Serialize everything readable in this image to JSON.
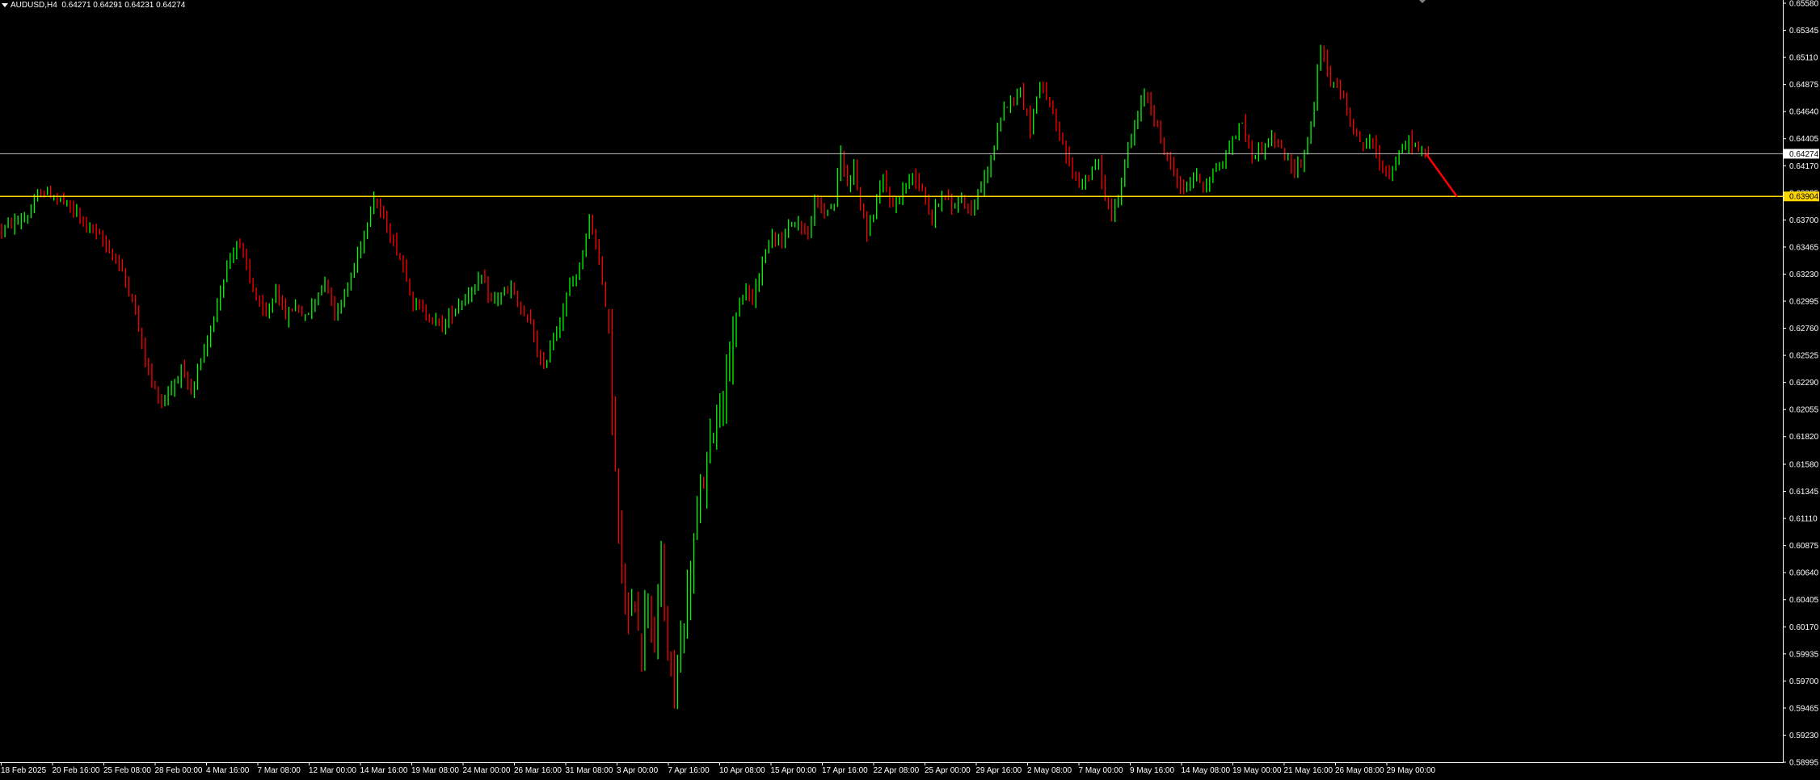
{
  "header": {
    "symbol": "AUDUSD,H4",
    "ohlc": "0.64271 0.64291 0.64231 0.64274"
  },
  "colors": {
    "background": "#000000",
    "bull": "#00ff00",
    "bear": "#ff0000",
    "axis": "#ffffff",
    "support_line": "#ffd700",
    "price_line": "#c0c0c0",
    "arrow": "#ff0000"
  },
  "chart_data": {
    "type": "candlestick",
    "y_ticks": [
      "0.65580",
      "0.65345",
      "0.65110",
      "0.64875",
      "0.64640",
      "0.64405",
      "0.64170",
      "0.63935",
      "0.63700",
      "0.63465",
      "0.63230",
      "0.62995",
      "0.62760",
      "0.62525",
      "0.62290",
      "0.62055",
      "0.61820",
      "0.61580",
      "0.61345",
      "0.61110",
      "0.60875",
      "0.60640",
      "0.60405",
      "0.60170",
      "0.59935",
      "0.59700",
      "0.59465",
      "0.59230",
      "0.58995"
    ],
    "ylim": [
      0.58995,
      0.6558
    ],
    "x_ticks": [
      "18 Feb 2025",
      "20 Feb 16:00",
      "25 Feb 08:00",
      "28 Feb 00:00",
      "4 Mar 16:00",
      "7 Mar 08:00",
      "12 Mar 00:00",
      "14 Mar 16:00",
      "19 Mar 08:00",
      "24 Mar 00:00",
      "26 Mar 16:00",
      "31 Mar 08:00",
      "3 Apr 00:00",
      "7 Apr 16:00",
      "10 Apr 08:00",
      "15 Apr 00:00",
      "17 Apr 16:00",
      "22 Apr 08:00",
      "25 Apr 00:00",
      "29 Apr 16:00",
      "2 May 08:00",
      "7 May 00:00",
      "9 May 16:00",
      "14 May 08:00",
      "19 May 00:00",
      "21 May 16:00",
      "26 May 08:00",
      "29 May 00:00"
    ],
    "current_price": "0.64274",
    "support_label": "0.63904",
    "support_value": 0.63904,
    "close_path": [
      [
        0,
        0.6362
      ],
      [
        8,
        0.6373
      ],
      [
        12,
        0.6395
      ],
      [
        18,
        0.6388
      ],
      [
        24,
        0.6372
      ],
      [
        28,
        0.6361
      ],
      [
        33,
        0.6345
      ],
      [
        37,
        0.6325
      ],
      [
        40,
        0.6302
      ],
      [
        43,
        0.6262
      ],
      [
        46,
        0.6228
      ],
      [
        49,
        0.6212
      ],
      [
        52,
        0.6225
      ],
      [
        55,
        0.624
      ],
      [
        58,
        0.6218
      ],
      [
        60,
        0.6238
      ],
      [
        63,
        0.6262
      ],
      [
        66,
        0.63
      ],
      [
        69,
        0.633
      ],
      [
        72,
        0.6352
      ],
      [
        75,
        0.633
      ],
      [
        78,
        0.63
      ],
      [
        81,
        0.6286
      ],
      [
        84,
        0.631
      ],
      [
        87,
        0.6286
      ],
      [
        90,
        0.6296
      ],
      [
        93,
        0.6285
      ],
      [
        96,
        0.63
      ],
      [
        99,
        0.632
      ],
      [
        102,
        0.629
      ],
      [
        105,
        0.6305
      ],
      [
        108,
        0.633
      ],
      [
        111,
        0.636
      ],
      [
        114,
        0.639
      ],
      [
        117,
        0.637
      ],
      [
        120,
        0.635
      ],
      [
        123,
        0.633
      ],
      [
        126,
        0.63
      ],
      [
        129,
        0.629
      ],
      [
        132,
        0.6285
      ],
      [
        135,
        0.6278
      ],
      [
        138,
        0.629
      ],
      [
        141,
        0.63
      ],
      [
        144,
        0.631
      ],
      [
        147,
        0.6318
      ],
      [
        150,
        0.63
      ],
      [
        153,
        0.6305
      ],
      [
        156,
        0.631
      ],
      [
        159,
        0.629
      ],
      [
        162,
        0.628
      ],
      [
        164,
        0.6255
      ],
      [
        166,
        0.624
      ],
      [
        168,
        0.6262
      ],
      [
        171,
        0.6282
      ],
      [
        174,
        0.6312
      ],
      [
        177,
        0.633
      ],
      [
        180,
        0.637
      ],
      [
        183,
        0.634
      ],
      [
        186,
        0.627
      ],
      [
        188,
        0.615
      ],
      [
        190,
        0.605
      ],
      [
        192,
        0.602
      ],
      [
        194,
        0.604
      ],
      [
        196,
        0.6
      ],
      [
        198,
        0.605
      ],
      [
        200,
        0.6
      ],
      [
        202,
        0.607
      ],
      [
        204,
        0.599
      ],
      [
        206,
        0.5965
      ],
      [
        208,
        0.6
      ],
      [
        210,
        0.604
      ],
      [
        212,
        0.609
      ],
      [
        214,
        0.613
      ],
      [
        216,
        0.616
      ],
      [
        218,
        0.619
      ],
      [
        220,
        0.621
      ],
      [
        222,
        0.624
      ],
      [
        224,
        0.627
      ],
      [
        226,
        0.6295
      ],
      [
        228,
        0.631
      ],
      [
        230,
        0.63
      ],
      [
        233,
        0.6335
      ],
      [
        236,
        0.636
      ],
      [
        239,
        0.635
      ],
      [
        242,
        0.637
      ],
      [
        245,
        0.6365
      ],
      [
        247,
        0.6355
      ],
      [
        249,
        0.6385
      ],
      [
        252,
        0.6377
      ],
      [
        255,
        0.6385
      ],
      [
        257,
        0.6428
      ],
      [
        259,
        0.64
      ],
      [
        261,
        0.642
      ],
      [
        263,
        0.638
      ],
      [
        265,
        0.636
      ],
      [
        267,
        0.6375
      ],
      [
        270,
        0.6405
      ],
      [
        273,
        0.638
      ],
      [
        276,
        0.6395
      ],
      [
        279,
        0.641
      ],
      [
        282,
        0.6398
      ],
      [
        285,
        0.637
      ],
      [
        288,
        0.6395
      ],
      [
        291,
        0.638
      ],
      [
        294,
        0.6392
      ],
      [
        297,
        0.6375
      ],
      [
        300,
        0.64
      ],
      [
        303,
        0.642
      ],
      [
        306,
        0.646
      ],
      [
        309,
        0.6475
      ],
      [
        312,
        0.6482
      ],
      [
        315,
        0.645
      ],
      [
        318,
        0.649
      ],
      [
        321,
        0.647
      ],
      [
        324,
        0.644
      ],
      [
        327,
        0.642
      ],
      [
        330,
        0.64
      ],
      [
        333,
        0.6408
      ],
      [
        336,
        0.642
      ],
      [
        338,
        0.639
      ],
      [
        340,
        0.6372
      ],
      [
        342,
        0.639
      ],
      [
        344,
        0.642
      ],
      [
        347,
        0.645
      ],
      [
        350,
        0.648
      ],
      [
        353,
        0.646
      ],
      [
        356,
        0.643
      ],
      [
        359,
        0.641
      ],
      [
        362,
        0.6395
      ],
      [
        365,
        0.641
      ],
      [
        368,
        0.64
      ],
      [
        371,
        0.641
      ],
      [
        374,
        0.642
      ],
      [
        377,
        0.644
      ],
      [
        380,
        0.6455
      ],
      [
        383,
        0.6425
      ],
      [
        386,
        0.6432
      ],
      [
        389,
        0.644
      ],
      [
        392,
        0.643
      ],
      [
        395,
        0.6415
      ],
      [
        398,
        0.642
      ],
      [
        401,
        0.645
      ],
      [
        404,
        0.652
      ],
      [
        407,
        0.649
      ],
      [
        410,
        0.648
      ],
      [
        413,
        0.646
      ],
      [
        416,
        0.6435
      ],
      [
        419,
        0.644
      ],
      [
        422,
        0.642
      ],
      [
        425,
        0.641
      ],
      [
        428,
        0.6425
      ],
      [
        431,
        0.644
      ],
      [
        434,
        0.643
      ],
      [
        437,
        0.64274
      ]
    ],
    "total_bars": 438
  }
}
